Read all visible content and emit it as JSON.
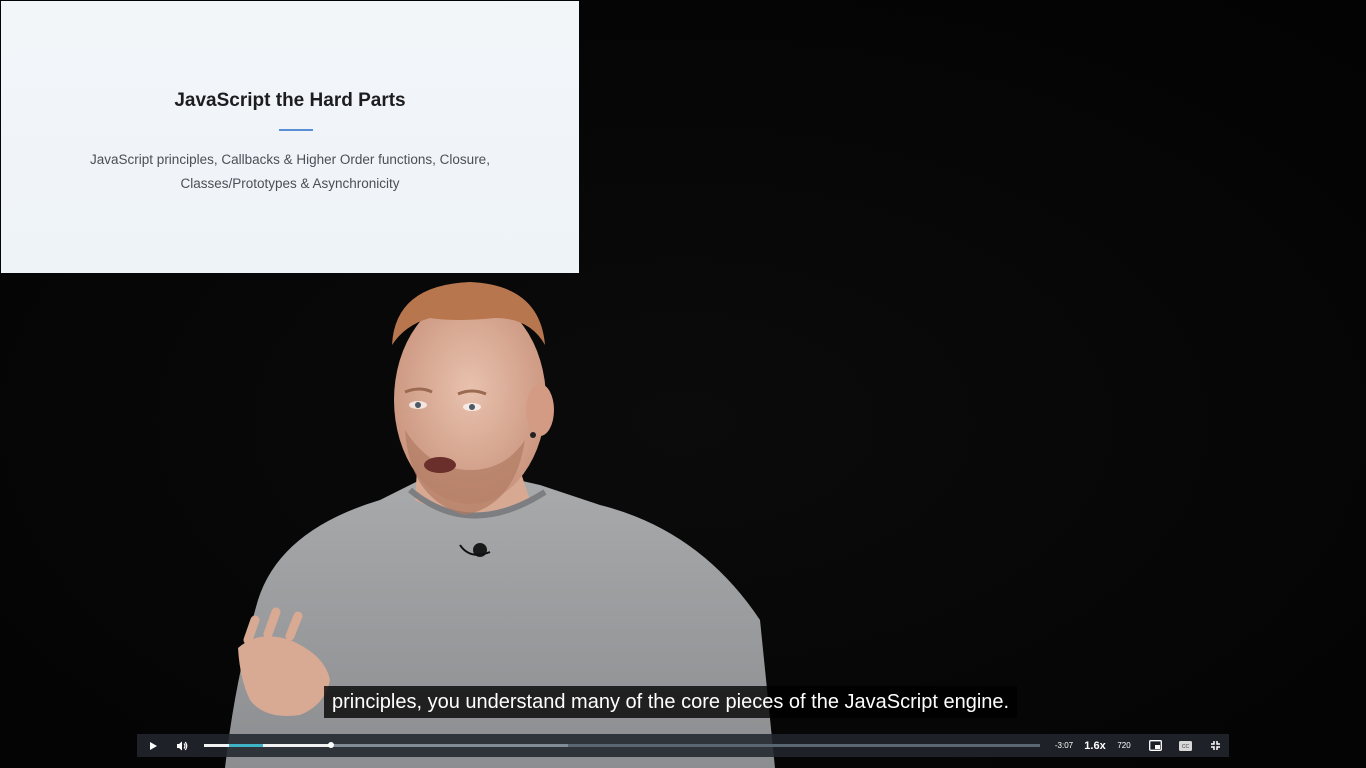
{
  "slide": {
    "title": "JavaScript the Hard Parts",
    "description_line1": "JavaScript principles, Callbacks & Higher Order functions, Closure,",
    "description_line2": "Classes/Prototypes & Asynchronicity"
  },
  "caption": "principles, you understand many of the core pieces of the JavaScript engine.",
  "player": {
    "time_remaining": "-3:07",
    "speed": "1.6x",
    "quality": "720",
    "progress": 0.152,
    "buffered": 0.435,
    "highlight_start": 0.03,
    "highlight_end": 0.07,
    "icons": {
      "play": "play-icon",
      "volume": "volume-icon",
      "pip": "picture-in-picture-icon",
      "captions": "captions-icon",
      "fullscreen": "exit-fullscreen-icon"
    },
    "colors": {
      "bar": "#22272e",
      "accent": "#3fb4c6"
    }
  }
}
